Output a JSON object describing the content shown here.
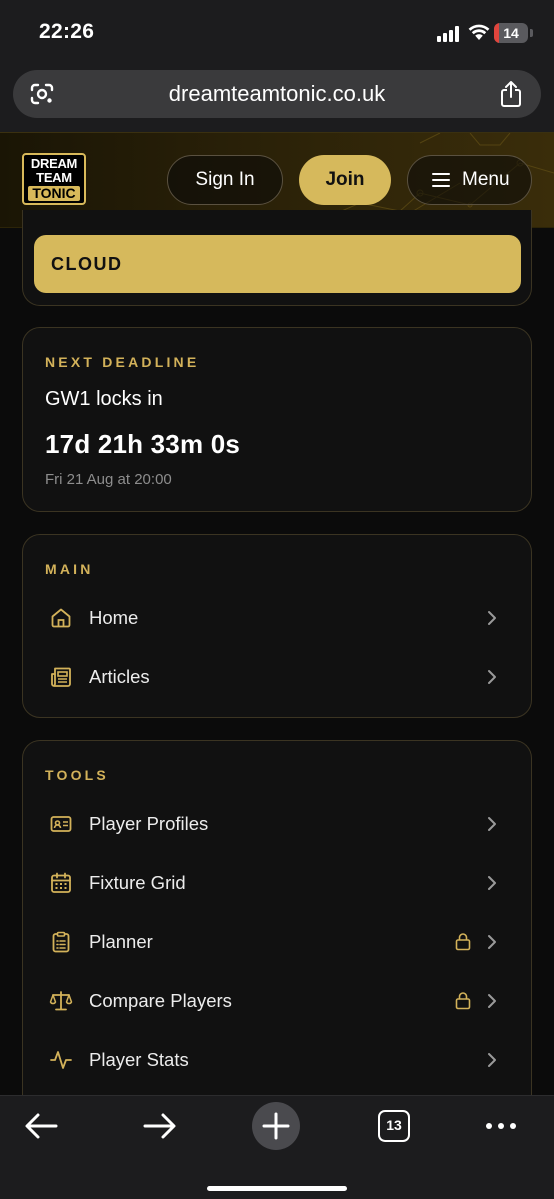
{
  "status_bar": {
    "time": "22:26",
    "battery": "14",
    "battery_level": 0.14
  },
  "browser": {
    "url": "dreamteamtonic.co.uk",
    "tab_count": "13"
  },
  "header": {
    "logo_lines": [
      "DREAM",
      "TEAM",
      "TONIC"
    ],
    "sign_in_label": "Sign In",
    "join_label": "Join",
    "menu_label": "Menu"
  },
  "cloud": {
    "label": "CLOUD"
  },
  "deadline": {
    "section_label": "NEXT DEADLINE",
    "title": "GW1 locks in",
    "countdown": "17d 21h 33m 0s",
    "date": "Fri 21 Aug at 20:00"
  },
  "main_section": {
    "label": "MAIN",
    "items": [
      {
        "label": "Home",
        "icon": "home-icon",
        "locked": false
      },
      {
        "label": "Articles",
        "icon": "newspaper-icon",
        "locked": false
      }
    ]
  },
  "tools_section": {
    "label": "TOOLS",
    "items": [
      {
        "label": "Player Profiles",
        "icon": "id-card-icon",
        "locked": false
      },
      {
        "label": "Fixture Grid",
        "icon": "calendar-icon",
        "locked": false
      },
      {
        "label": "Planner",
        "icon": "clipboard-icon",
        "locked": true
      },
      {
        "label": "Compare Players",
        "icon": "scales-icon",
        "locked": true
      },
      {
        "label": "Player Stats",
        "icon": "activity-icon",
        "locked": false
      }
    ]
  },
  "colors": {
    "accent": "#d6b95c",
    "background": "#0b0b0b",
    "card": "#111111",
    "border": "#3b3422",
    "battery_low": "#e0453d"
  }
}
